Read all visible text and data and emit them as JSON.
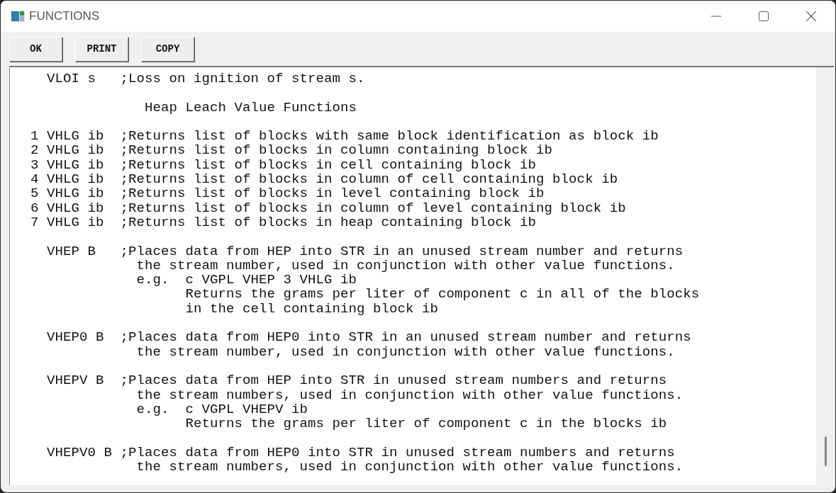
{
  "window": {
    "title": "FUNCTIONS"
  },
  "buttons": [
    "OK",
    "PRINT",
    "COPY"
  ],
  "text_blocks": [
    [
      "  VLOI s   ;Loss on ignition of stream s."
    ],
    [
      "              Heap Leach Value Functions"
    ],
    [
      "1 VHLG ib  ;Returns list of blocks with same block identification as block ib",
      "2 VHLG ib  ;Returns list of blocks in column containing block ib",
      "3 VHLG ib  ;Returns list of blocks in cell containing block ib",
      "4 VHLG ib  ;Returns list of blocks in column of cell containing block ib",
      "5 VHLG ib  ;Returns list of blocks in level containing block ib",
      "6 VHLG ib  ;Returns list of blocks in column of level containing block ib",
      "7 VHLG ib  ;Returns list of blocks in heap containing block ib"
    ],
    [
      "  VHEP B   ;Places data from HEP into STR in an unused stream number and returns",
      "             the stream number, used in conjunction with other value functions.",
      "             e.g.  c VGPL VHEP 3 VHLG ib",
      "                   Returns the grams per liter of component c in all of the blocks",
      "                   in the cell containing block ib"
    ],
    [
      "  VHEP0 B  ;Places data from HEP0 into STR in an unused stream number and returns",
      "             the stream number, used in conjunction with other value functions."
    ],
    [
      "  VHEPV B  ;Places data from HEP into STR in unused stream numbers and returns",
      "             the stream numbers, used in conjunction with other value functions.",
      "             e.g.  c VGPL VHEPV ib",
      "                   Returns the grams per liter of component c in the blocks ib"
    ],
    [
      "  VHEPV0 B ;Places data from HEP0 into STR in unused stream numbers and returns",
      "             the stream numbers, used in conjunction with other value functions."
    ]
  ]
}
